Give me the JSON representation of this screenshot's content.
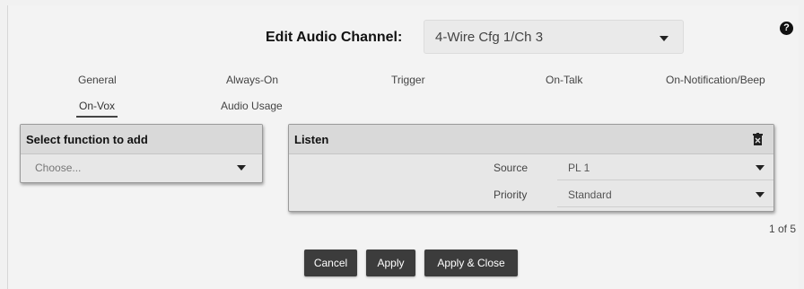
{
  "header": {
    "title": "Edit Audio Channel:",
    "channel_value": "4-Wire Cfg 1/Ch 3",
    "help_icon": "question-circle-icon"
  },
  "tabs": [
    {
      "label": "General"
    },
    {
      "label": "Always-On"
    },
    {
      "label": "Trigger"
    },
    {
      "label": "On-Talk"
    },
    {
      "label": "On-Notification/Beep"
    },
    {
      "label": "On-Vox",
      "active": true
    },
    {
      "label": "Audio Usage"
    }
  ],
  "function_panel": {
    "title": "Select function to add",
    "placeholder": "Choose..."
  },
  "listen_panel": {
    "title": "Listen",
    "delete_icon": "trash-icon",
    "fields": [
      {
        "label": "Source",
        "value": "PL 1"
      },
      {
        "label": "Priority",
        "value": "Standard"
      }
    ]
  },
  "pager": "1 of 5",
  "buttons": {
    "cancel": "Cancel",
    "apply": "Apply",
    "apply_close": "Apply & Close"
  },
  "colors": {
    "background": "#f3f3f3",
    "panel": "#e7e7e7",
    "panel_header": "#d9d9d9",
    "button": "#3c3c3c"
  }
}
